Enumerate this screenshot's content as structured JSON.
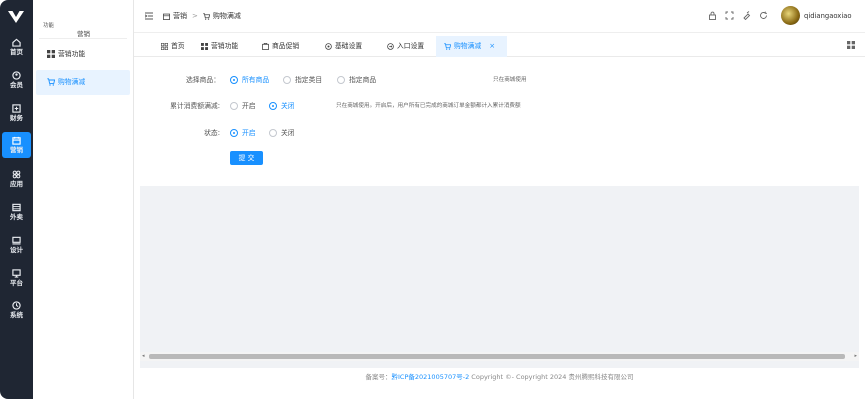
{
  "rail": {
    "items": [
      {
        "label": "首页",
        "icon": "home-icon"
      },
      {
        "label": "会员",
        "icon": "member-icon"
      },
      {
        "label": "财务",
        "icon": "finance-icon"
      },
      {
        "label": "营销",
        "icon": "marketing-icon",
        "active": true
      },
      {
        "label": "应用",
        "icon": "apps-icon"
      },
      {
        "label": "外卖",
        "icon": "takeout-icon"
      },
      {
        "label": "设计",
        "icon": "design-icon"
      },
      {
        "label": "平台",
        "icon": "platform-icon"
      },
      {
        "label": "系统",
        "icon": "system-icon"
      }
    ]
  },
  "sub": {
    "tiny_label": "功能",
    "heading": "营销",
    "items": [
      {
        "label": "营销功能",
        "icon": "grid-icon"
      },
      {
        "label": "购物满减",
        "icon": "cart-icon",
        "active": true
      }
    ]
  },
  "header": {
    "breadcrumb": [
      "营销",
      "购物满减"
    ],
    "username": "qidiangaoxiao"
  },
  "tabs": [
    {
      "label": "首页",
      "icon": "home-tab-icon"
    },
    {
      "label": "营销功能",
      "icon": "grid-tab-icon"
    },
    {
      "label": "商品促销",
      "icon": "promo-icon"
    },
    {
      "label": "基础设置",
      "icon": "settings-icon"
    },
    {
      "label": "入口设置",
      "icon": "entry-icon"
    },
    {
      "label": "购物满减",
      "icon": "cart-tab-icon",
      "active": true,
      "close": "×"
    }
  ],
  "form": {
    "select_goods": {
      "label": "选择商品：",
      "options": [
        "所有商品",
        "指定类目",
        "指定商品"
      ],
      "selected": "所有商品",
      "hint": "只在商城使用"
    },
    "cumulative": {
      "label": "累计消费额满减:",
      "options": [
        "开启",
        "关闭"
      ],
      "selected": "关闭",
      "hint": "只在商城使用。开启后，用户所有已完成的商城订单金额都计入累计消费额"
    },
    "status": {
      "label": "状态:",
      "options": [
        "开启",
        "关闭"
      ],
      "selected": "开启"
    },
    "submit_label": "提 交"
  },
  "footer": {
    "prefix": "备案号：",
    "icp": "黔ICP备2021005707号-2",
    "copyright": " Copyright ©- Copyright 2024 贵州腾熙科技有限公司"
  },
  "colors": {
    "rail_bg": "#1f2633",
    "accent": "#1890ff",
    "canvas_bg": "#f0f2f5"
  }
}
